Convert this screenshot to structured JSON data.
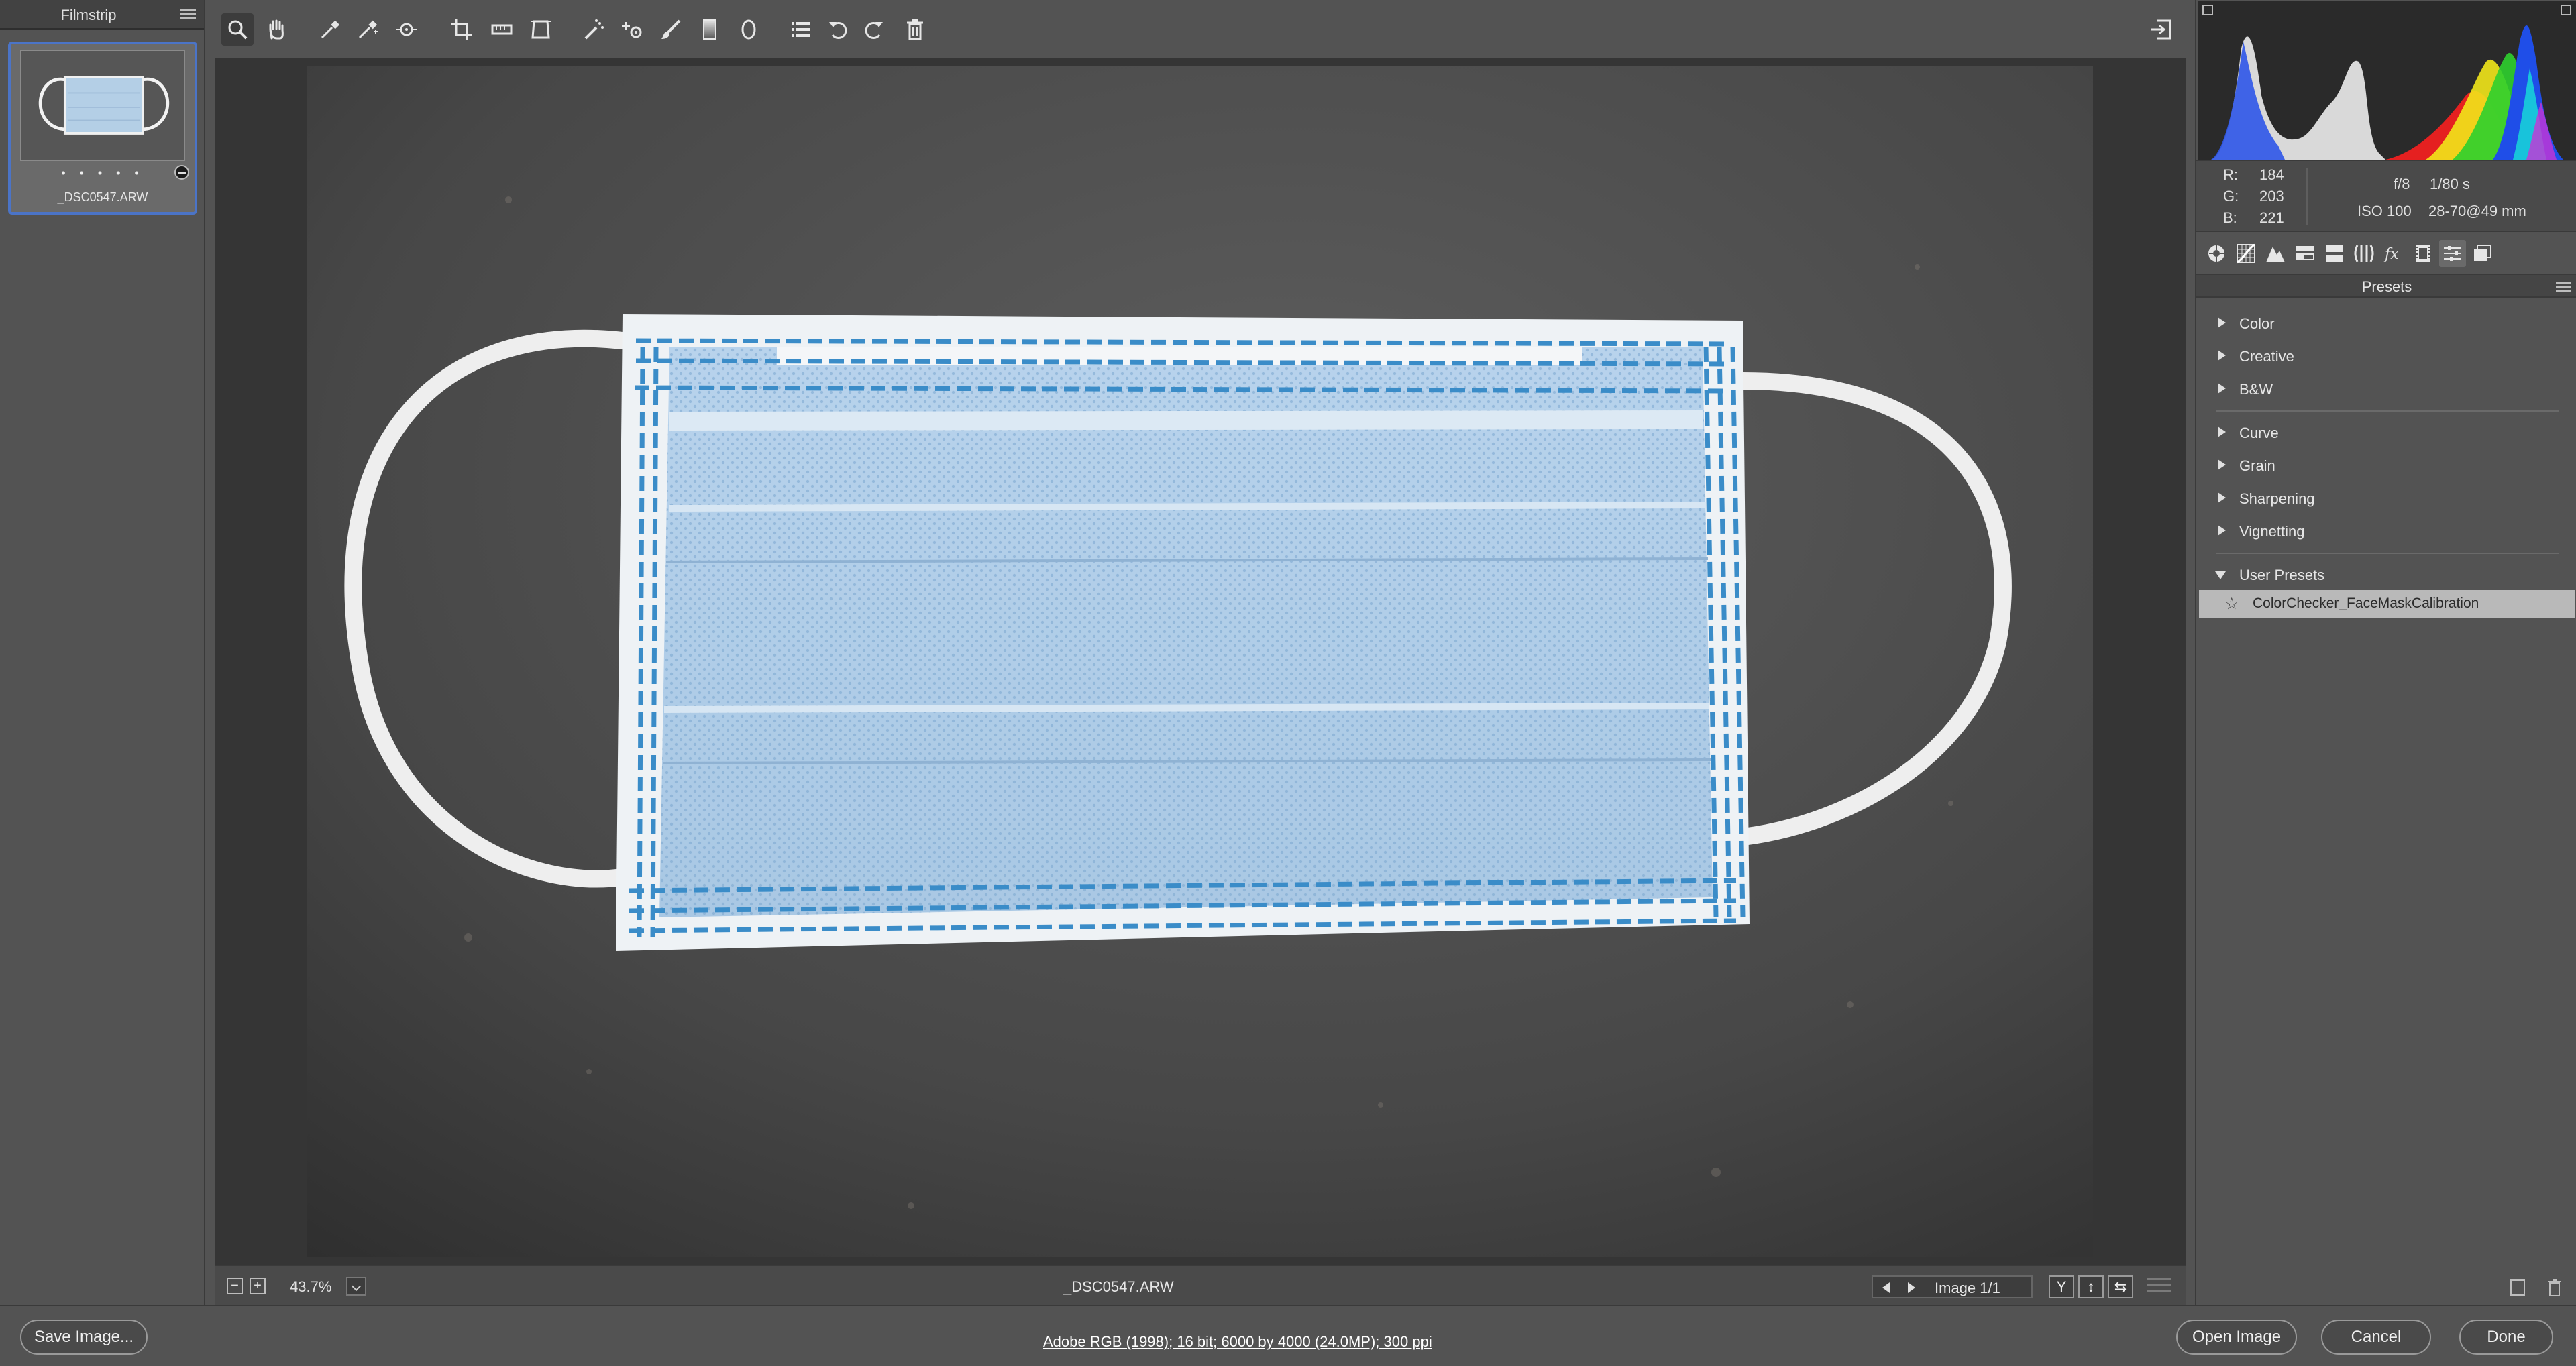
{
  "filmstrip": {
    "title": "Filmstrip",
    "thumbnail": {
      "filename": "_DSC0547.ARW",
      "rating_dots": "• • • • •"
    }
  },
  "toolbar": {
    "tools": [
      "zoom-icon",
      "hand-icon",
      "white-balance-icon",
      "color-sampler-icon",
      "target-adjust-icon",
      "crop-icon",
      "straighten-icon",
      "transform-icon",
      "spot-removal-icon",
      "red-eye-icon",
      "adjustment-brush-icon",
      "graduated-filter-icon",
      "radial-filter-icon",
      "preferences-icon",
      "rotate-left-icon",
      "rotate-right-icon",
      "trash-icon"
    ],
    "fullscreen_icon": "fullscreen-icon"
  },
  "canvas_status": {
    "zoom_minus": "−",
    "zoom_plus": "+",
    "zoom": "43.7%",
    "filename": "_DSC0547.ARW",
    "image_nav": "Image 1/1",
    "view_buttons": [
      "Y",
      "↕",
      "⇆"
    ]
  },
  "info": {
    "r_label": "R:",
    "r": "184",
    "g_label": "G:",
    "g": "203",
    "b_label": "B:",
    "b": "221",
    "aperture": "f/8",
    "shutter": "1/80 s",
    "iso": "ISO 100",
    "lens": "28-70@49 mm"
  },
  "panel_tabs": [
    "basic-icon",
    "tone-curve-icon",
    "detail-icon",
    "hsl-icon",
    "split-toning-icon",
    "lens-corrections-icon",
    "effects-icon",
    "camera-calibration-icon",
    "presets-icon",
    "snapshots-icon"
  ],
  "presets": {
    "title": "Presets",
    "groups_a": [
      "Color",
      "Creative",
      "B&W"
    ],
    "groups_b": [
      "Curve",
      "Grain",
      "Sharpening",
      "Vignetting"
    ],
    "user_group": "User Presets",
    "user_items": [
      "ColorChecker_FaceMaskCalibration"
    ]
  },
  "bottom": {
    "save": "Save Image...",
    "workflow": "Adobe RGB (1998); 16 bit; 6000 by 4000 (24.0MP); 300 ppi",
    "open": "Open Image",
    "cancel": "Cancel",
    "done": "Done"
  },
  "colors": {
    "accent": "#4b74c7",
    "panel": "#535353",
    "canvas": "#353535",
    "selected_preset": "#b9b9b9"
  }
}
